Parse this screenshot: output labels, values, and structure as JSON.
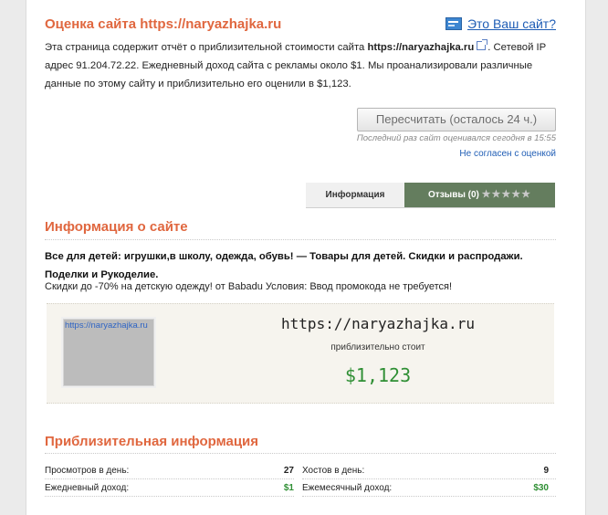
{
  "header": {
    "title": "Оценка сайта https://naryazhajka.ru",
    "own_site_link": "Это Ваш сайт?"
  },
  "intro": {
    "part1": "Эта страница содержит отчёт о приблизительной стоимости сайта ",
    "site": "https://naryazhajka.ru",
    "part2": ". Сетевой IP адрес 91.204.72.22. Ежедневный доход сайта с рекламы около $1. Мы проанализировали различные данные по этому сайту и приблизительно его оценили в $1,123."
  },
  "actions": {
    "recalc_button": "Пересчитать (осталось 24 ч.)",
    "last_evaluated": "Последний раз сайт оценивался сегодня в 15:55",
    "disagree_link": "Не согласен с оценкой"
  },
  "tabs": {
    "info": "Информация",
    "reviews": "Отзывы (0)",
    "stars": "★★★★★"
  },
  "site_info": {
    "title": "Информация о сайте",
    "description_bold": "Все для детей: игрушки,в школу, одежда, обувь! — Товары для детей. Скидки и распродажи. Поделки и Рукоделие.",
    "description": "Скидки до -70% на детскую одежду! от Babadu Условия: Ввод промокода не требуется!"
  },
  "valuation": {
    "thumb_label": "https://naryazhajka.ru",
    "site_url": "https://naryazhajka.ru",
    "approx_label": "приблизительно стоит",
    "price": "$1,123",
    "price_color": "#2f8f34"
  },
  "approx_info": {
    "title": "Приблизительная информация",
    "views_label": "Просмотров в день:",
    "views_value": "27",
    "hosts_label": "Хостов в день:",
    "hosts_value": "9",
    "daily_income_label": "Ежедневный доход:",
    "daily_income_value": "$1",
    "monthly_income_label": "Ежемесячный доход:",
    "monthly_income_value": "$30"
  },
  "colors": {
    "accent": "#e0673f",
    "link": "#1f5db5",
    "reviews_tab": "#647d5e"
  }
}
